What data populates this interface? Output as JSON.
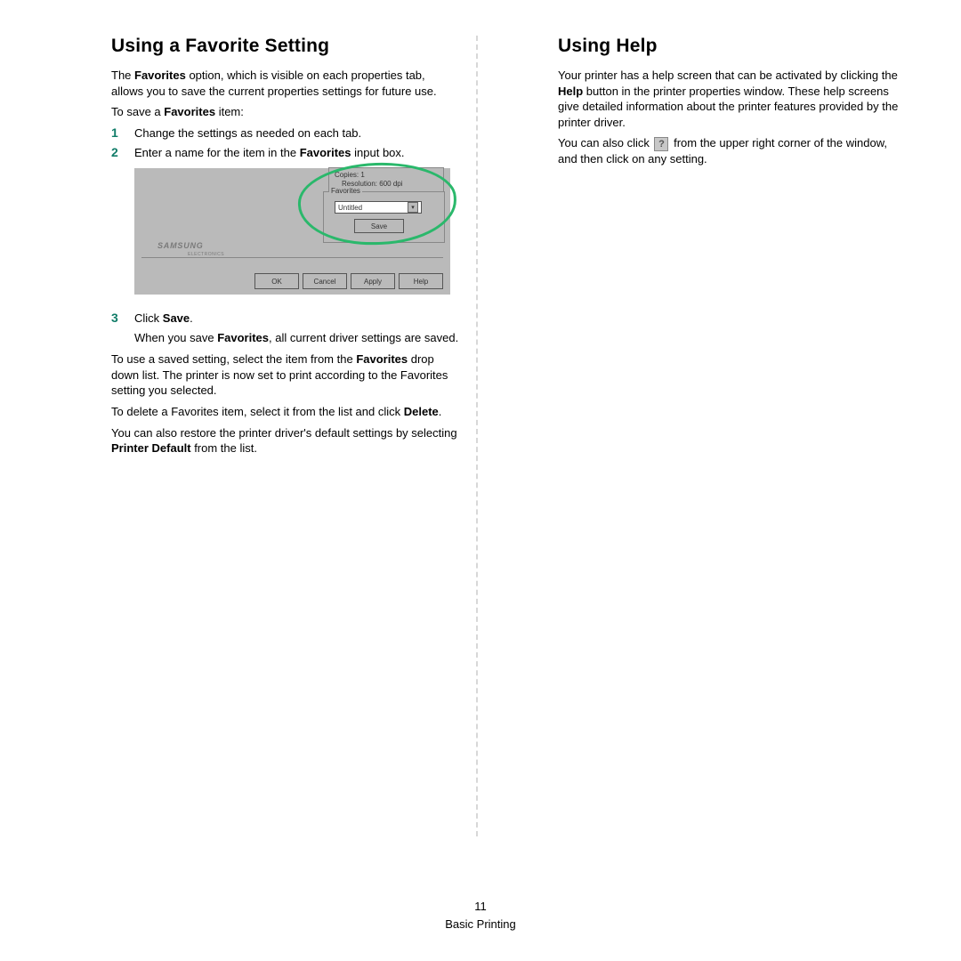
{
  "page_number": "11",
  "footer_text": "Basic Printing",
  "left": {
    "heading": "Using a Favorite Setting",
    "intro_a": "The ",
    "intro_b": "Favorites",
    "intro_c": " option, which is visible on each properties tab, allows you to save the current properties settings for future use.",
    "save_a": "To save a ",
    "save_b": "Favorites",
    "save_c": " item:",
    "steps12": [
      {
        "n": "1",
        "a": "Change the settings as needed on each tab.",
        "b": "",
        "c": ""
      },
      {
        "n": "2",
        "a": "Enter a name for the item in the ",
        "b": "Favorites",
        "c": " input box."
      }
    ],
    "step3": {
      "n": "3",
      "a": "Click ",
      "b": "Save",
      "c": ".",
      "sub_a": "When you save ",
      "sub_b": "Favorites",
      "sub_c": ", all current driver settings are saved."
    },
    "use_a": "To use a saved setting, select the item from the ",
    "use_b": "Favorites",
    "use_c": " drop down list. The printer is now set to print according to the Favorites setting you selected.",
    "del_a": "To delete a Favorites item, select it from the list and click ",
    "del_b": "Delete",
    "del_c": ".",
    "def_a": "You can also restore the printer driver's default settings by selecting ",
    "def_b": "Printer Default",
    "def_c": " from the list."
  },
  "right": {
    "heading": "Using Help",
    "p1_a": "Your printer has a help screen that can be activated by clicking the ",
    "p1_b": "Help",
    "p1_c": " button in the printer properties window. These help screens give detailed information about the printer features provided by the printer driver.",
    "p2_a": "You can also click ",
    "p2_icon": "?",
    "p2_b": " from the upper right corner of the window, and then click on any setting."
  },
  "screenshot": {
    "copies": "Copies: 1",
    "resolution": "Resolution: 600 dpi",
    "fav_legend": "Favorites",
    "dropdown_value": "Untitled",
    "save": "Save",
    "logo": "SAMSUNG",
    "logo_sub": "ELECTRONICS",
    "buttons": [
      "OK",
      "Cancel",
      "Apply",
      "Help"
    ]
  }
}
